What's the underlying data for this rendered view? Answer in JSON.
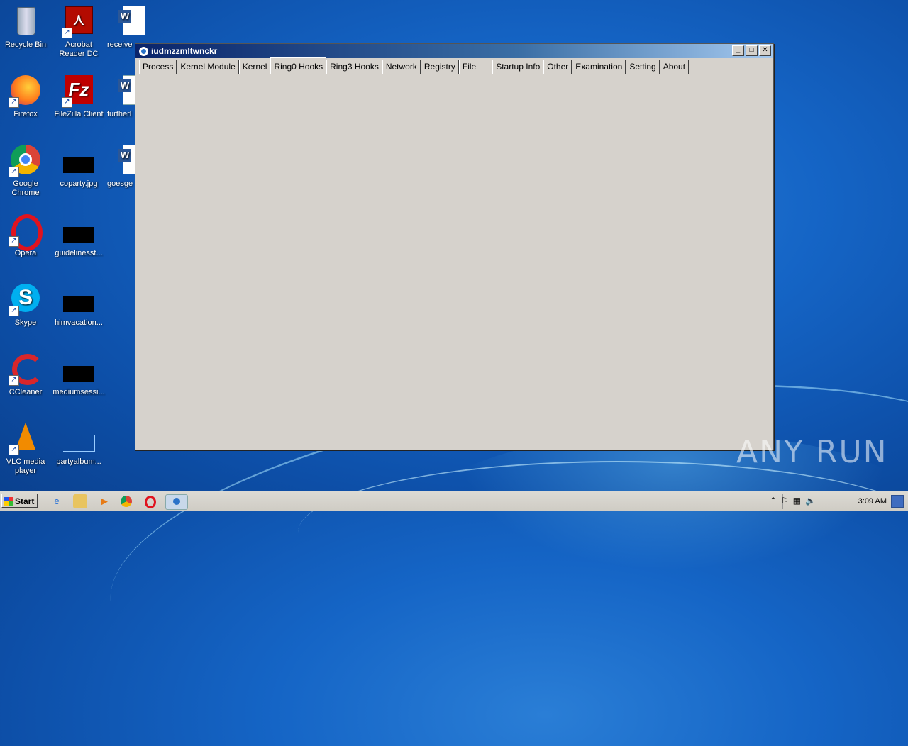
{
  "desktop": {
    "icons": [
      {
        "label": "Recycle Bin"
      },
      {
        "label": "Acrobat Reader DC"
      },
      {
        "label": "receive"
      },
      {
        "label": "Firefox"
      },
      {
        "label": "FileZilla Client"
      },
      {
        "label": "furtherl"
      },
      {
        "label": "Google Chrome"
      },
      {
        "label": "coparty.jpg"
      },
      {
        "label": "goesge"
      },
      {
        "label": "Opera"
      },
      {
        "label": "guidelinesst..."
      },
      {
        "label": "Skype"
      },
      {
        "label": "himvacation..."
      },
      {
        "label": "CCleaner"
      },
      {
        "label": "mediumsessi..."
      },
      {
        "label": "VLC media player"
      },
      {
        "label": "partyalbum..."
      }
    ]
  },
  "window": {
    "title": "iudmzzmltwnckr",
    "controls": {
      "minimize": "_",
      "maximize": "□",
      "close": "✕"
    },
    "tabs": [
      "Process",
      "Kernel Module",
      "Kernel",
      "Ring0 Hooks",
      "Ring3 Hooks",
      "Network",
      "Registry",
      "File",
      "Startup Info",
      "Other",
      "Examination",
      "Setting",
      "About"
    ],
    "active_tab": "Ring0 Hooks"
  },
  "taskbar": {
    "start_label": "Start",
    "clock": "3:09 AM",
    "pinned": [
      "ie-icon",
      "explorer-icon",
      "media-player-icon",
      "chrome-icon",
      "opera-icon",
      "app-icon"
    ]
  },
  "watermark": "ANY RUN",
  "colors": {
    "desktop": "#1565c6",
    "window_bg": "#d6d2cc",
    "titlebar": "#0a246a"
  }
}
